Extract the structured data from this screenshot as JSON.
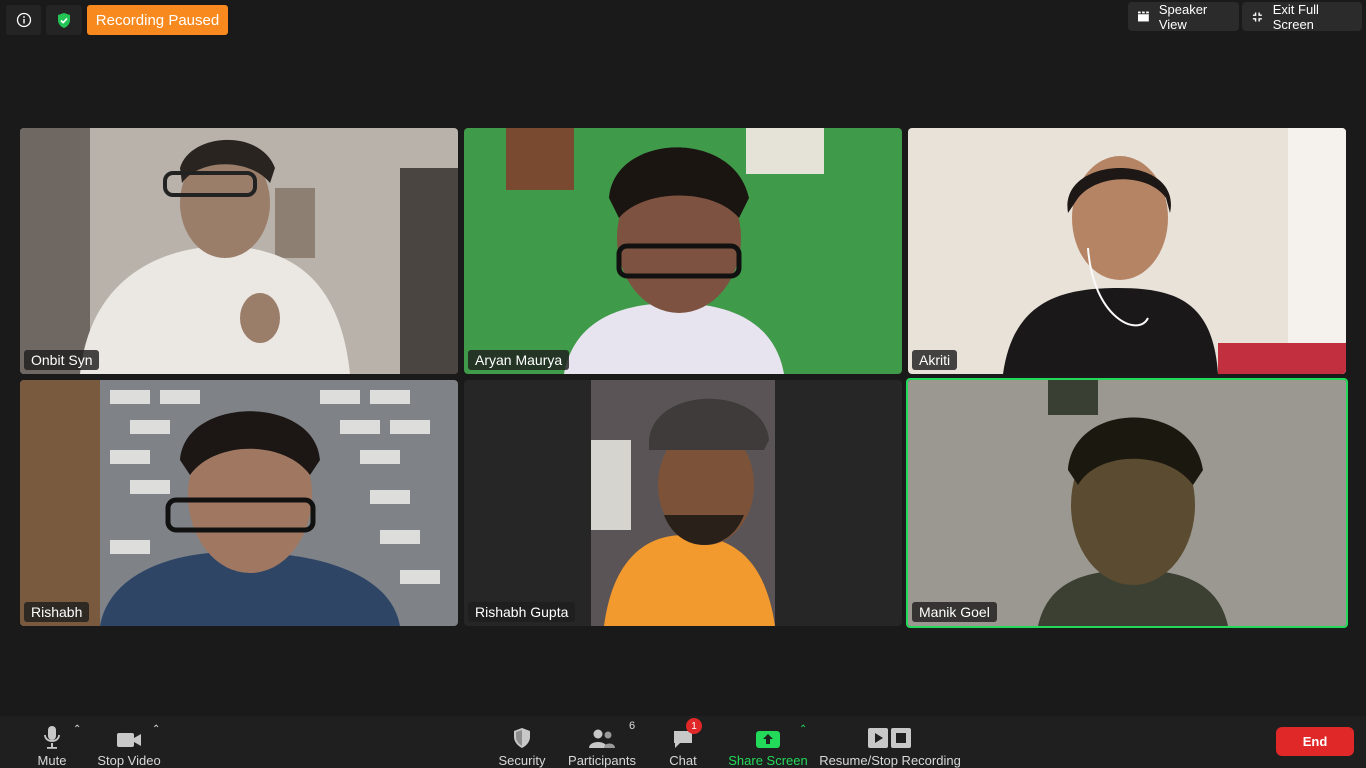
{
  "topbar": {
    "info_icon": "info-icon",
    "shield_icon": "shield-check-icon",
    "recording_status": "Recording Paused",
    "speaker_view_label": "Speaker View",
    "exit_fullscreen_label": "Exit Full Screen"
  },
  "participants_grid": [
    {
      "name": "Onbit Syn",
      "active": false
    },
    {
      "name": "Aryan Maurya",
      "active": false
    },
    {
      "name": "Akriti",
      "active": false
    },
    {
      "name": "Rishabh",
      "active": false
    },
    {
      "name": "Rishabh Gupta",
      "active": false
    },
    {
      "name": "Manik Goel",
      "active": true
    }
  ],
  "toolbar": {
    "mute_label": "Mute",
    "stop_video_label": "Stop Video",
    "security_label": "Security",
    "participants_label": "Participants",
    "participants_count": "6",
    "chat_label": "Chat",
    "chat_badge": "1",
    "share_screen_label": "Share Screen",
    "recording_label": "Resume/Stop Recording",
    "end_label": "End"
  },
  "colors": {
    "recording_badge": "#f7891e",
    "active_speaker_border": "#23d959",
    "end_button": "#e02828",
    "share_screen": "#23d959"
  }
}
